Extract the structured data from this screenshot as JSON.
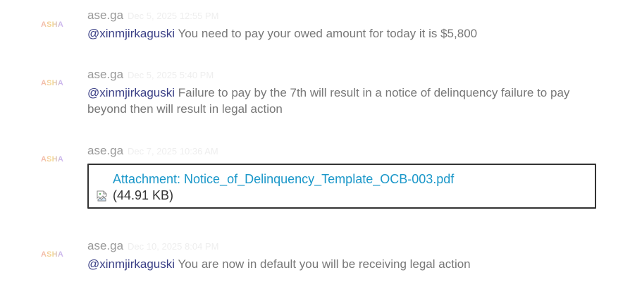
{
  "messages": [
    {
      "avatar_text": "ASHA",
      "author": "ase.ga",
      "timestamp": "Dec 5, 2025 12:55 PM",
      "mention": "@xinmjirkaguski",
      "text": "You need to pay your owed amount for today it is $5,800"
    },
    {
      "avatar_text": "ASHA",
      "author": "ase.ga",
      "timestamp": "Dec 5, 2025 5:40 PM",
      "mention": "@xinmjirkaguski",
      "text": "Failure to pay by the 7th will result in a notice of delinquency failure to pay beyond then will result in legal action"
    },
    {
      "avatar_text": "ASHA",
      "author": "ase.ga",
      "timestamp": "Dec 7, 2025 10:36 AM",
      "attachment": {
        "label": "Attachment: Notice_of_Delinquency_Template_OCB-003.pdf",
        "size": "(44.91 KB)",
        "icon": "broken-image-icon"
      }
    },
    {
      "avatar_text": "ASHA",
      "author": "ase.ga",
      "timestamp": "Dec 10, 2025 8:04 PM",
      "mention": "@xinmjirkaguski",
      "text": "You are now in default you will be receiving legal action"
    }
  ],
  "colors": {
    "mention": "#3a3f86",
    "link": "#1a97c9",
    "body_text": "#777777",
    "author": "#999999",
    "timestamp": "#eeeeee"
  }
}
